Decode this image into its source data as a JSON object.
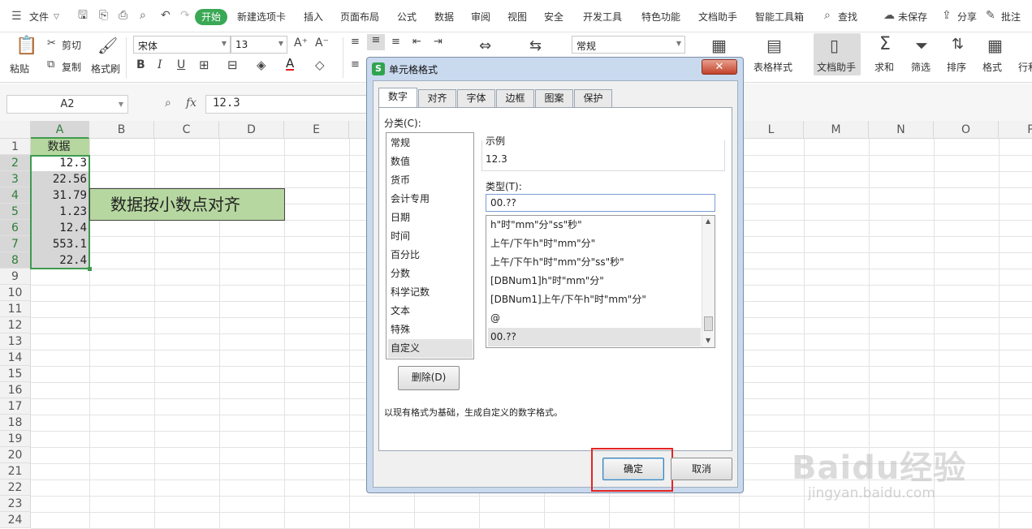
{
  "menubar": {
    "file": "文件",
    "tabs": [
      "开始",
      "新建选项卡",
      "插入",
      "页面布局",
      "公式",
      "数据",
      "审阅",
      "视图",
      "安全",
      "开发工具",
      "特色功能",
      "文档助手",
      "智能工具箱"
    ],
    "search": "查找",
    "unsaved": "未保存",
    "share": "分享",
    "comment": "批注"
  },
  "ribbon": {
    "paste": "粘贴",
    "cut": "剪切",
    "copy": "复制",
    "format_painter": "格式刷",
    "font_name": "宋体",
    "font_size": "13",
    "number_format": "常规",
    "table_style": "表格样式",
    "doc_assistant": "文档助手",
    "sum": "求和",
    "filter": "筛选",
    "sort": "排序",
    "format": "格式",
    "rowcol": "行和"
  },
  "formula_bar": {
    "name_box": "A2",
    "fx": "fx",
    "value": "12.3"
  },
  "sheet": {
    "columns": [
      "A",
      "B",
      "C",
      "D",
      "E",
      "F",
      "G",
      "H",
      "I",
      "J",
      "K",
      "L",
      "M",
      "N",
      "O",
      "P"
    ],
    "rows": [
      "1",
      "2",
      "3",
      "4",
      "5",
      "6",
      "7",
      "8",
      "9",
      "10",
      "11",
      "12",
      "13",
      "14",
      "15",
      "16",
      "17",
      "18",
      "19",
      "20",
      "21",
      "22",
      "23",
      "24"
    ],
    "header_cell": "数据",
    "values": [
      "12.3",
      "22.56",
      "31.79",
      "1.23",
      "12.4",
      "553.1",
      "22.4"
    ],
    "note": "数据按小数点对齐"
  },
  "dialog": {
    "title": "单元格格式",
    "tabs": [
      "数字",
      "对齐",
      "字体",
      "边框",
      "图案",
      "保护"
    ],
    "category_label": "分类(C):",
    "categories": [
      "常规",
      "数值",
      "货币",
      "会计专用",
      "日期",
      "时间",
      "百分比",
      "分数",
      "科学记数",
      "文本",
      "特殊",
      "自定义"
    ],
    "sample_label": "示例",
    "sample_value": "12.3",
    "type_label": "类型(T):",
    "type_value": "00.??",
    "formats": [
      "h\"时\"mm\"分\"ss\"秒\"",
      "上午/下午h\"时\"mm\"分\"",
      "上午/下午h\"时\"mm\"分\"ss\"秒\"",
      "[DBNum1]h\"时\"mm\"分\"",
      "[DBNum1]上午/下午h\"时\"mm\"分\"",
      "@",
      "00.??"
    ],
    "delete_button": "删除(D)",
    "description": "以现有格式为基础，生成自定义的数字格式。",
    "ok_button": "确定",
    "cancel_button": "取消"
  },
  "watermark": {
    "brand": "Baidu经验",
    "url": "jingyan.baidu.com"
  }
}
